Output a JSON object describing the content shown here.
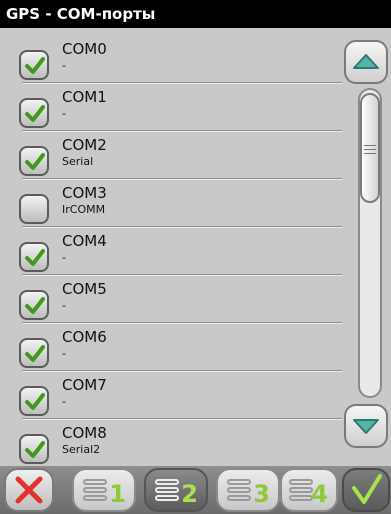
{
  "title": "GPS - COM-порты",
  "ports": [
    {
      "name": "COM0",
      "sub": "-",
      "checked": true
    },
    {
      "name": "COM1",
      "sub": "-",
      "checked": true
    },
    {
      "name": "COM2",
      "sub": "Serial",
      "checked": true
    },
    {
      "name": "COM3",
      "sub": "IrCOMM",
      "checked": false
    },
    {
      "name": "COM4",
      "sub": "-",
      "checked": true
    },
    {
      "name": "COM5",
      "sub": "-",
      "checked": true
    },
    {
      "name": "COM6",
      "sub": "-",
      "checked": true
    },
    {
      "name": "COM7",
      "sub": "-",
      "checked": true
    },
    {
      "name": "COM8",
      "sub": "Serial2",
      "checked": true
    }
  ],
  "toolbar": {
    "tabs": [
      "1",
      "2",
      "3",
      "4"
    ],
    "active_tab": "2"
  },
  "colors": {
    "check": "#3f9a1e",
    "cancel": "#e0332b",
    "tab_number": "#8fc83a"
  },
  "icons": {
    "cancel": "red-x-icon",
    "ok": "checkmark-icon",
    "tab": "list-lines-icon",
    "scroll_up": "triangle-up-icon",
    "scroll_down": "triangle-down-icon"
  }
}
